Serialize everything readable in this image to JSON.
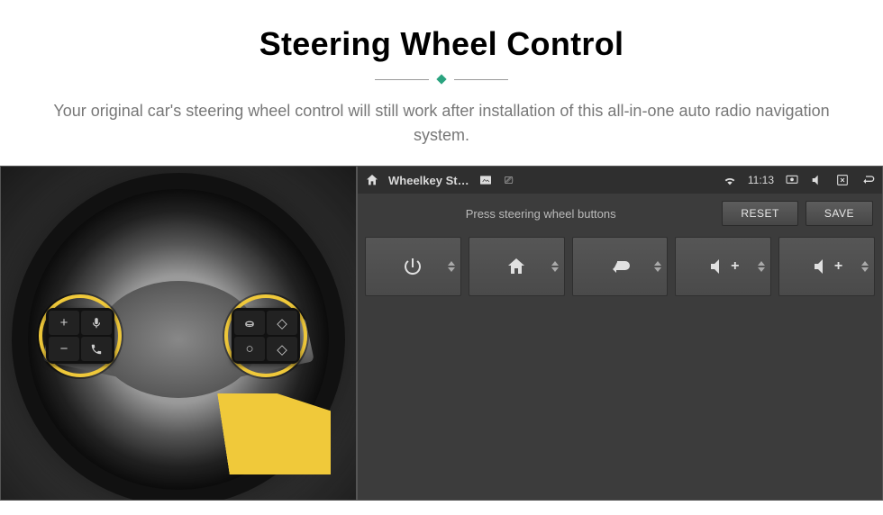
{
  "header": {
    "title": "Steering Wheel Control",
    "subtitle": "Your original car's steering wheel control will still work after installation of this all-in-one auto radio navigation system."
  },
  "wheel": {
    "left_cluster": {
      "buttons": [
        "plus-icon",
        "voice-icon",
        "minus-icon",
        "phone-icon"
      ]
    },
    "right_cluster": {
      "buttons": [
        "source-icon",
        "diamond-icon",
        "circle-icon",
        "diamond2-icon"
      ]
    },
    "arrow_color": "#f0c93a"
  },
  "screen": {
    "statusbar": {
      "app_label": "Wheelkey St…",
      "indicators": [
        "image-icon",
        "usb-icon"
      ],
      "time": "11:13",
      "right_icons": [
        "wifi-icon",
        "cast-icon",
        "mute-icon",
        "close-app-icon",
        "back-icon"
      ]
    },
    "toolbar": {
      "instruction": "Press steering wheel buttons",
      "reset_label": "RESET",
      "save_label": "SAVE"
    },
    "tiles": [
      {
        "name": "power-tile",
        "icon": "power-icon"
      },
      {
        "name": "home-tile",
        "icon": "home-icon"
      },
      {
        "name": "back-tile",
        "icon": "return-icon"
      },
      {
        "name": "vol-up-tile-1",
        "icon": "volume-up-icon"
      },
      {
        "name": "vol-up-tile-2",
        "icon": "volume-up-icon"
      }
    ]
  },
  "colors": {
    "accent": "#2aa37f",
    "highlight": "#f0c93a"
  }
}
